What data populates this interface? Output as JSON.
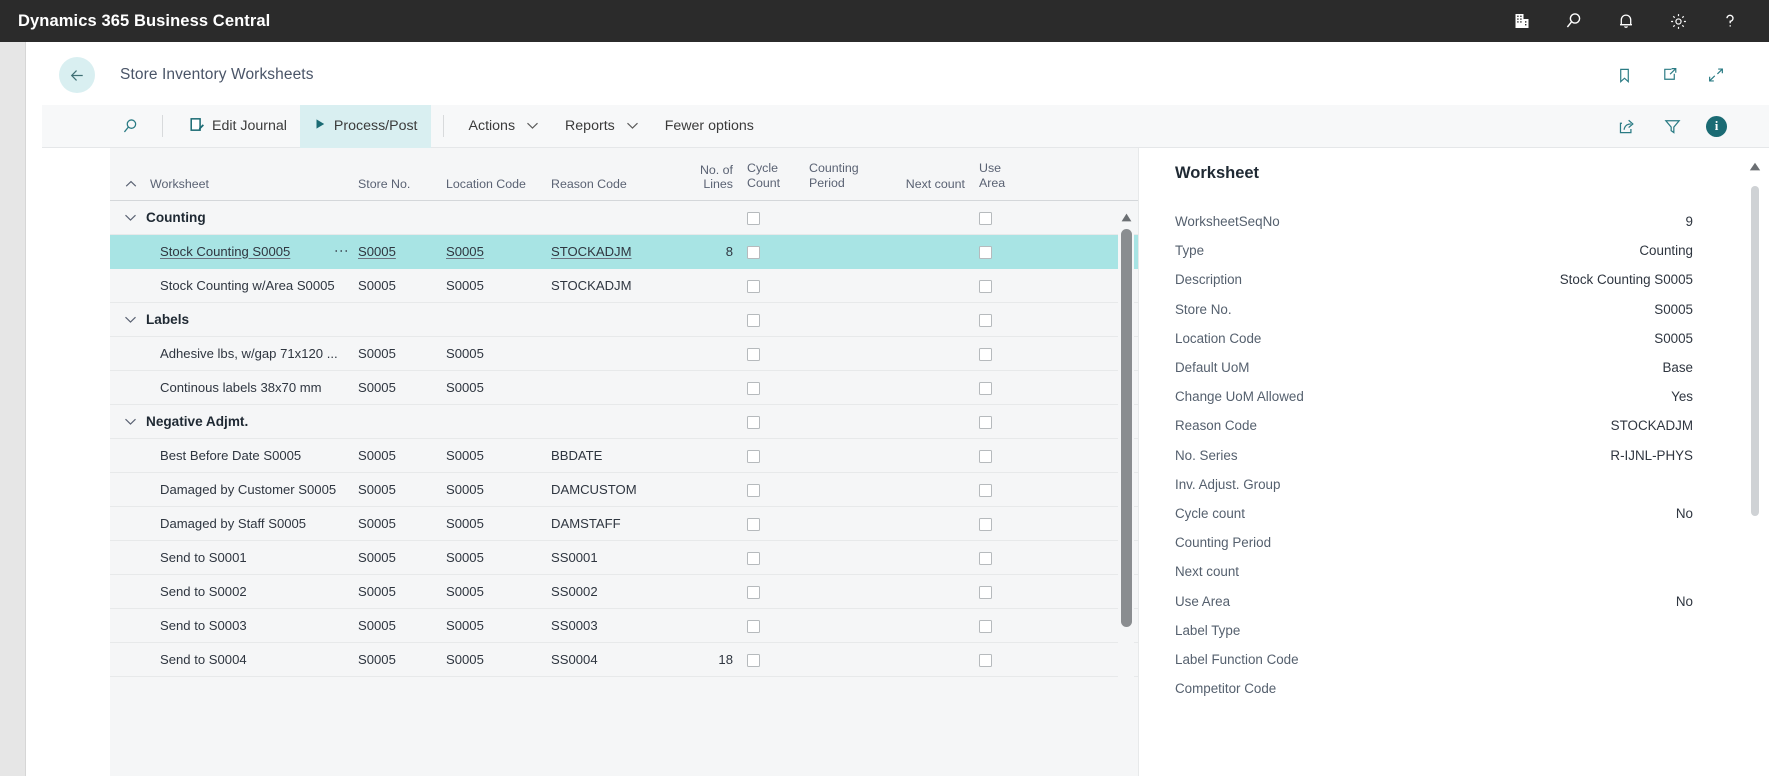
{
  "topbar": {
    "app_title": "Dynamics 365 Business Central",
    "icons": [
      {
        "name": "company-icon",
        "label": "Company"
      },
      {
        "name": "search-icon",
        "label": "Search"
      },
      {
        "name": "notification-bell-icon",
        "label": "Notifications"
      },
      {
        "name": "settings-gear-icon",
        "label": "Settings"
      },
      {
        "name": "help-question-icon",
        "label": "Help"
      }
    ],
    "background": "#2b2b2b"
  },
  "page_header": {
    "back_label": "Back",
    "title": "Store Inventory Worksheets",
    "icons": [
      {
        "name": "bookmark-icon",
        "label": "Bookmark"
      },
      {
        "name": "open-in-new-window-icon",
        "label": "Open in new window"
      },
      {
        "name": "collapse-icon",
        "label": "Collapse"
      }
    ]
  },
  "ribbon": {
    "search_label": "Search",
    "items": [
      {
        "name": "edit-journal",
        "label": "Edit Journal",
        "icon": "edit-journal-icon",
        "active": false,
        "caret": false
      },
      {
        "name": "process-post",
        "label": "Process/Post",
        "icon": "play-triangle-icon",
        "active": true,
        "caret": false
      },
      {
        "name": "actions",
        "label": "Actions",
        "icon": "",
        "active": false,
        "caret": true
      },
      {
        "name": "reports",
        "label": "Reports",
        "icon": "",
        "active": false,
        "caret": true
      },
      {
        "name": "fewer-options",
        "label": "Fewer options",
        "icon": "",
        "active": false,
        "caret": false
      }
    ],
    "right_icons": [
      {
        "name": "share-icon",
        "label": "Share"
      },
      {
        "name": "filter-icon",
        "label": "Filter"
      },
      {
        "name": "info-badge-icon",
        "label": "i"
      }
    ],
    "accent_color": "#1b6b74",
    "active_background": "#d9eff1"
  },
  "list": {
    "columns": [
      {
        "key": "worksheet",
        "label": "Worksheet",
        "line1": "",
        "line2": "Worksheet",
        "align": "left"
      },
      {
        "key": "store_no",
        "label": "Store No.",
        "line1": "",
        "line2": "Store No.",
        "align": "left"
      },
      {
        "key": "location_code",
        "label": "Location Code",
        "line1": "",
        "line2": "Location Code",
        "align": "left"
      },
      {
        "key": "reason_code",
        "label": "Reason Code",
        "line1": "",
        "line2": "Reason Code",
        "align": "left"
      },
      {
        "key": "no_of_lines",
        "label": "No. of Lines",
        "line1": "",
        "line2": "No. of Lines",
        "align": "right"
      },
      {
        "key": "cycle_count",
        "label": "Cycle Count",
        "line1": "Cycle",
        "line2": "Count",
        "align": "left"
      },
      {
        "key": "counting_period",
        "label": "Counting Period",
        "line1": "Counting",
        "line2": "Period",
        "align": "left"
      },
      {
        "key": "next_count",
        "label": "Next count",
        "line1": "",
        "line2": "Next count",
        "align": "right"
      },
      {
        "key": "use_area",
        "label": "Use Area",
        "line1": "Use",
        "line2": "Area",
        "align": "left"
      }
    ],
    "sort_indicator": "ascending",
    "rows": [
      {
        "type": "group",
        "label": "Counting",
        "expanded": true,
        "cycle_count": false,
        "use_area": false
      },
      {
        "type": "item",
        "selected": true,
        "worksheet": "Stock Counting S0005",
        "store_no": "S0005",
        "location_code": "S0005",
        "reason_code": "STOCKADJM",
        "no_of_lines": "8",
        "cycle_count": false,
        "counting_period": "",
        "next_count": "",
        "use_area": false
      },
      {
        "type": "item",
        "selected": false,
        "worksheet": "Stock Counting w/Area S0005",
        "store_no": "S0005",
        "location_code": "S0005",
        "reason_code": "STOCKADJM",
        "no_of_lines": "",
        "cycle_count": false,
        "counting_period": "",
        "next_count": "",
        "use_area": false
      },
      {
        "type": "group",
        "label": "Labels",
        "expanded": true,
        "cycle_count": false,
        "use_area": false
      },
      {
        "type": "item",
        "selected": false,
        "worksheet": "Adhesive lbs, w/gap 71x120 ...",
        "store_no": "S0005",
        "location_code": "S0005",
        "reason_code": "",
        "no_of_lines": "",
        "cycle_count": false,
        "counting_period": "",
        "next_count": "",
        "use_area": false
      },
      {
        "type": "item",
        "selected": false,
        "worksheet": "Continous labels 38x70 mm",
        "store_no": "S0005",
        "location_code": "S0005",
        "reason_code": "",
        "no_of_lines": "",
        "cycle_count": false,
        "counting_period": "",
        "next_count": "",
        "use_area": false
      },
      {
        "type": "group",
        "label": "Negative Adjmt.",
        "expanded": true,
        "cycle_count": false,
        "use_area": false
      },
      {
        "type": "item",
        "selected": false,
        "worksheet": "Best Before Date S0005",
        "store_no": "S0005",
        "location_code": "S0005",
        "reason_code": "BBDATE",
        "no_of_lines": "",
        "cycle_count": false,
        "counting_period": "",
        "next_count": "",
        "use_area": false
      },
      {
        "type": "item",
        "selected": false,
        "worksheet": "Damaged by Customer S0005",
        "store_no": "S0005",
        "location_code": "S0005",
        "reason_code": "DAMCUSTOM",
        "no_of_lines": "",
        "cycle_count": false,
        "counting_period": "",
        "next_count": "",
        "use_area": false
      },
      {
        "type": "item",
        "selected": false,
        "worksheet": "Damaged by Staff S0005",
        "store_no": "S0005",
        "location_code": "S0005",
        "reason_code": "DAMSTAFF",
        "no_of_lines": "",
        "cycle_count": false,
        "counting_period": "",
        "next_count": "",
        "use_area": false
      },
      {
        "type": "item",
        "selected": false,
        "worksheet": "Send to S0001",
        "store_no": "S0005",
        "location_code": "S0005",
        "reason_code": "SS0001",
        "no_of_lines": "",
        "cycle_count": false,
        "counting_period": "",
        "next_count": "",
        "use_area": false
      },
      {
        "type": "item",
        "selected": false,
        "worksheet": "Send to S0002",
        "store_no": "S0005",
        "location_code": "S0005",
        "reason_code": "SS0002",
        "no_of_lines": "",
        "cycle_count": false,
        "counting_period": "",
        "next_count": "",
        "use_area": false
      },
      {
        "type": "item",
        "selected": false,
        "worksheet": "Send to S0003",
        "store_no": "S0005",
        "location_code": "S0005",
        "reason_code": "SS0003",
        "no_of_lines": "",
        "cycle_count": false,
        "counting_period": "",
        "next_count": "",
        "use_area": false
      },
      {
        "type": "item",
        "selected": false,
        "worksheet": "Send to S0004",
        "store_no": "S0005",
        "location_code": "S0005",
        "reason_code": "SS0004",
        "no_of_lines": "18",
        "cycle_count": false,
        "counting_period": "",
        "next_count": "",
        "use_area": false
      }
    ],
    "selected_row_background": "#a8e4e4"
  },
  "factbox": {
    "title": "Worksheet",
    "fields": [
      {
        "label": "WorksheetSeqNo",
        "value": "9"
      },
      {
        "label": "Type",
        "value": "Counting"
      },
      {
        "label": "Description",
        "value": "Stock Counting S0005"
      },
      {
        "label": "Store No.",
        "value": "S0005"
      },
      {
        "label": "Location Code",
        "value": "S0005"
      },
      {
        "label": "Default UoM",
        "value": "Base"
      },
      {
        "label": "Change UoM Allowed",
        "value": "Yes"
      },
      {
        "label": "Reason Code",
        "value": "STOCKADJM"
      },
      {
        "label": "No. Series",
        "value": "R-IJNL-PHYS"
      },
      {
        "label": "Inv. Adjust. Group",
        "value": ""
      },
      {
        "label": "Cycle count",
        "value": "No"
      },
      {
        "label": "Counting Period",
        "value": ""
      },
      {
        "label": "Next count",
        "value": ""
      },
      {
        "label": "Use Area",
        "value": "No"
      },
      {
        "label": "Label Type",
        "value": ""
      },
      {
        "label": "Label Function Code",
        "value": ""
      },
      {
        "label": "Competitor Code",
        "value": ""
      }
    ]
  }
}
